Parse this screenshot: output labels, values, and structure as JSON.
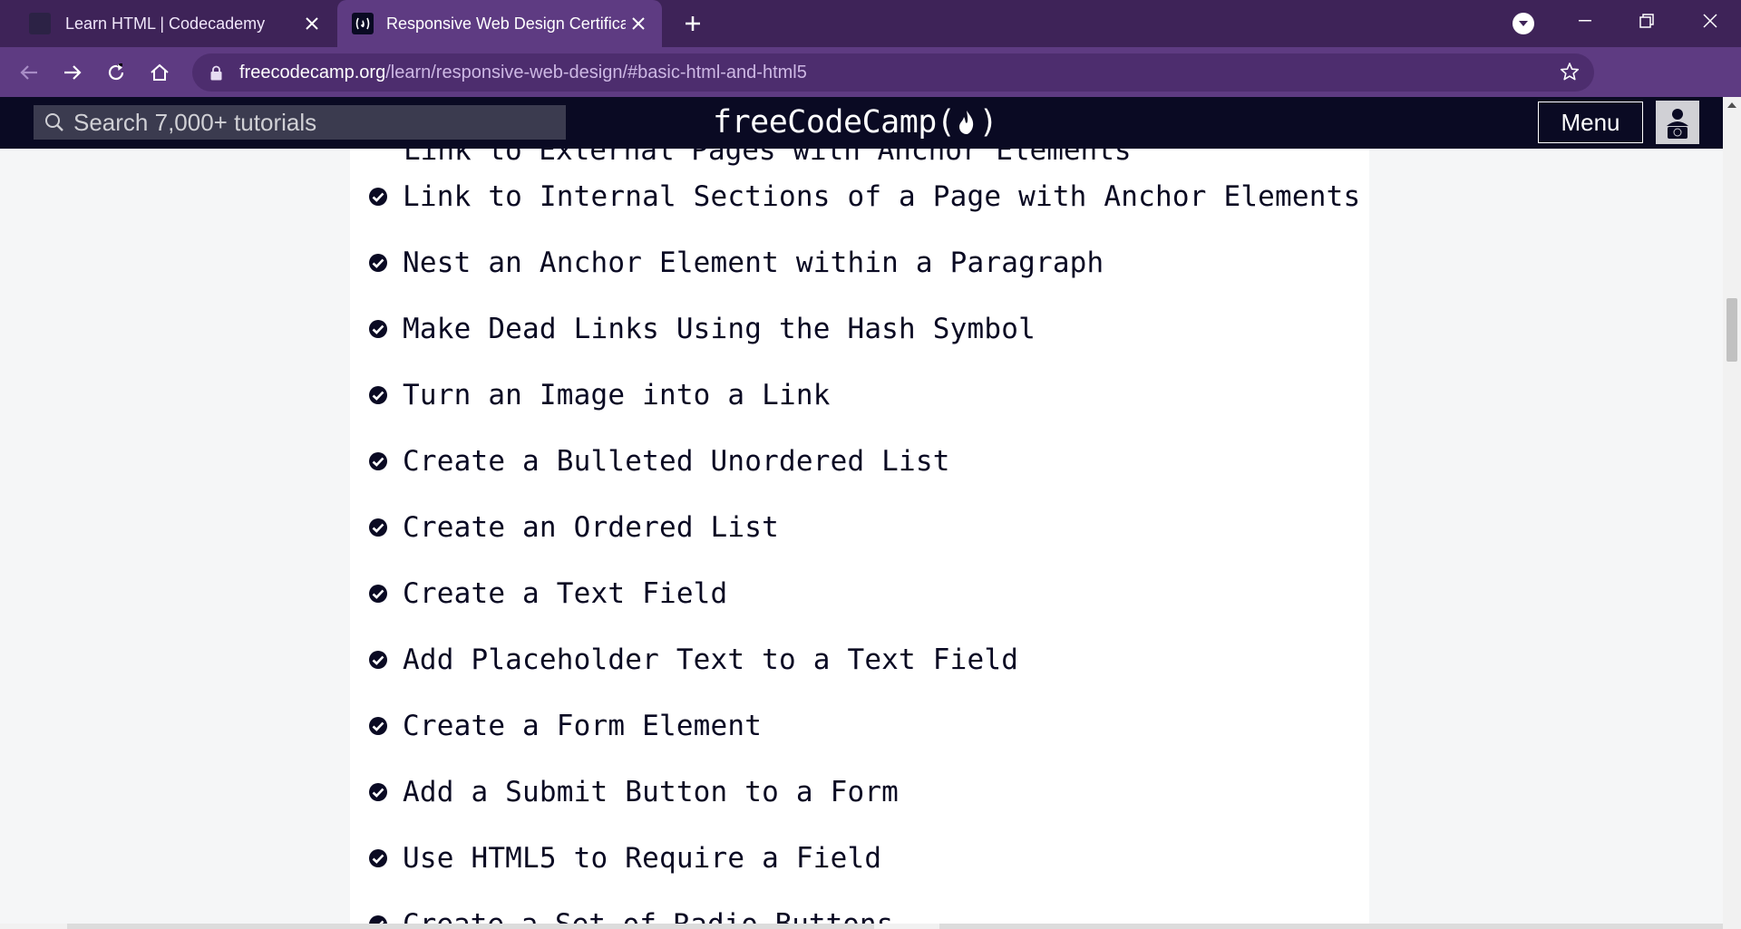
{
  "browser": {
    "tabs": [
      {
        "title": "Learn HTML | Codecademy",
        "active": false
      },
      {
        "title": "Responsive Web Design Certificat",
        "active": true
      }
    ],
    "url_domain": "freecodecamp.org",
    "url_path": "/learn/responsive-web-design/#basic-html-and-html5",
    "colors": {
      "tabstrip": "#3e2358",
      "toolbar": "#5e3b82"
    }
  },
  "fcc_nav": {
    "search_placeholder": "Search 7,000+ tutorials",
    "logo_text_left": "freeCodeCamp(",
    "logo_text_right": ")",
    "menu_label": "Menu",
    "colors": {
      "background": "#0a0a23"
    }
  },
  "lessons": {
    "partial_top": "Link to External Pages with Anchor Elements",
    "items": [
      {
        "label": "Link to Internal Sections of a Page with Anchor Elements",
        "completed": true
      },
      {
        "label": "Nest an Anchor Element within a Paragraph",
        "completed": true
      },
      {
        "label": "Make Dead Links Using the Hash Symbol",
        "completed": true
      },
      {
        "label": "Turn an Image into a Link",
        "completed": true
      },
      {
        "label": "Create a Bulleted Unordered List",
        "completed": true
      },
      {
        "label": "Create an Ordered List",
        "completed": true
      },
      {
        "label": "Create a Text Field",
        "completed": true
      },
      {
        "label": "Add Placeholder Text to a Text Field",
        "completed": true
      },
      {
        "label": "Create a Form Element",
        "completed": true
      },
      {
        "label": "Add a Submit Button to a Form",
        "completed": true
      },
      {
        "label": "Use HTML5 to Require a Field",
        "completed": true
      }
    ],
    "partial_bottom": "Create a Set of Radio Buttons"
  }
}
